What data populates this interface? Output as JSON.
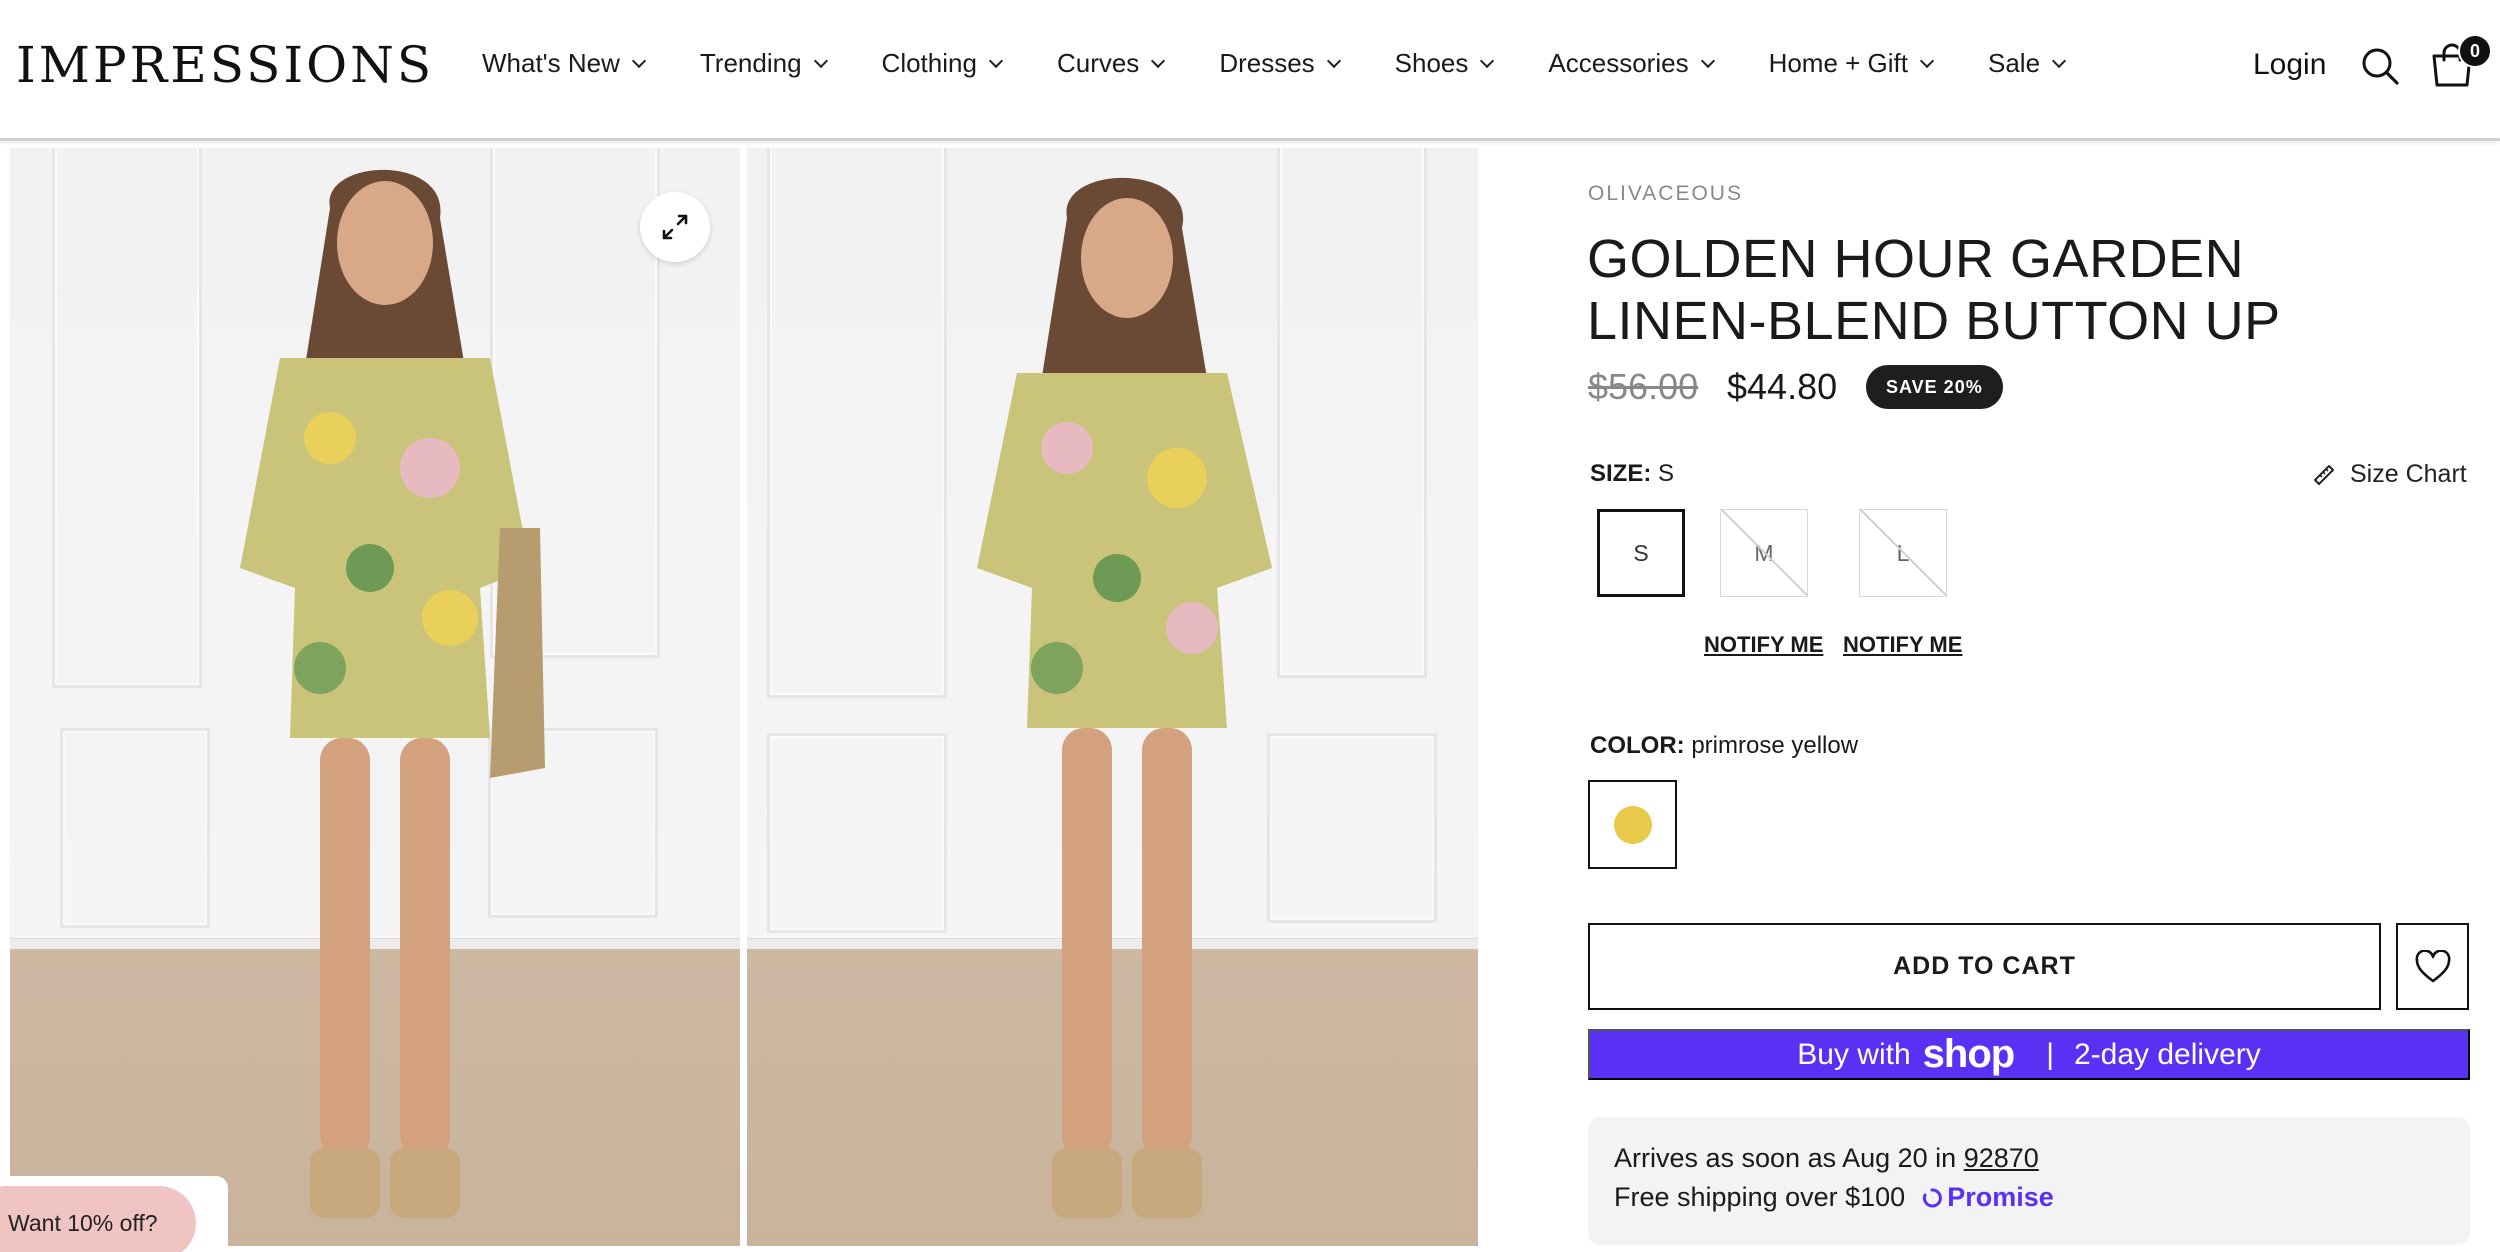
{
  "header": {
    "logo": "IMPRESSIONS",
    "nav": [
      "What's New",
      "Trending",
      "Clothing",
      "Curves",
      "Dresses",
      "Shoes",
      "Accessories",
      "Home + Gift",
      "Sale"
    ],
    "login": "Login",
    "cart_count": "0",
    "icons": {
      "search": "search-icon",
      "cart": "shopping-bag-icon"
    }
  },
  "gallery": {
    "expand_icon": "expand-icon",
    "promo": "Want 10% off?"
  },
  "product": {
    "brand": "OLIVACEOUS",
    "title": "GOLDEN HOUR GARDEN LINEN-BLEND BUTTON UP",
    "price_original": "$56.00",
    "price_sale": "$44.80",
    "save_badge": "SAVE 20%",
    "size": {
      "label": "SIZE:",
      "selected": "S",
      "chart_label": "Size Chart",
      "options": [
        {
          "value": "S",
          "available": true
        },
        {
          "value": "M",
          "available": false,
          "notify": "NOTIFY ME"
        },
        {
          "value": "L",
          "available": false,
          "notify": "NOTIFY ME"
        }
      ]
    },
    "color": {
      "label": "COLOR:",
      "selected": "primrose yellow",
      "swatch_color": "#e8c94a"
    },
    "add_to_cart": "ADD TO CART",
    "shop_pay": {
      "prefix": "Buy with",
      "brand": "shop",
      "suffix": "2-day delivery",
      "color": "#5a31f4"
    },
    "delivery": {
      "arrives_prefix": "Arrives as soon as Aug 20 in",
      "zip": "92870",
      "free_shipping": "Free shipping over $100",
      "promise": "Promise"
    }
  }
}
